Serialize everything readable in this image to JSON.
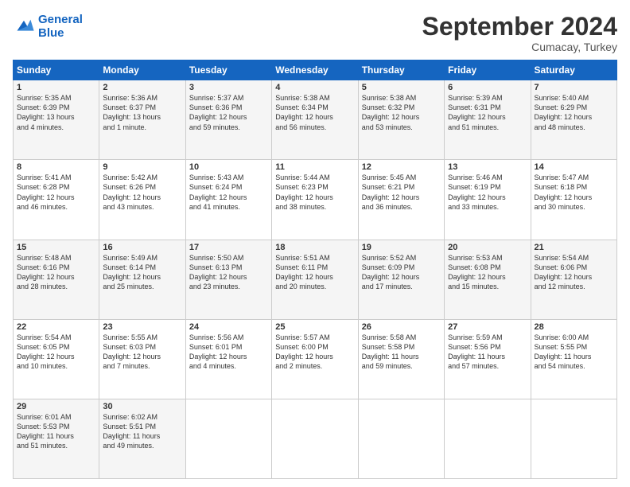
{
  "logo": {
    "line1": "General",
    "line2": "Blue"
  },
  "title": "September 2024",
  "location": "Cumacay, Turkey",
  "weekdays": [
    "Sunday",
    "Monday",
    "Tuesday",
    "Wednesday",
    "Thursday",
    "Friday",
    "Saturday"
  ],
  "rows": [
    [
      {
        "day": "1",
        "info": "Sunrise: 5:35 AM\nSunset: 6:39 PM\nDaylight: 13 hours\nand 4 minutes."
      },
      {
        "day": "2",
        "info": "Sunrise: 5:36 AM\nSunset: 6:37 PM\nDaylight: 13 hours\nand 1 minute."
      },
      {
        "day": "3",
        "info": "Sunrise: 5:37 AM\nSunset: 6:36 PM\nDaylight: 12 hours\nand 59 minutes."
      },
      {
        "day": "4",
        "info": "Sunrise: 5:38 AM\nSunset: 6:34 PM\nDaylight: 12 hours\nand 56 minutes."
      },
      {
        "day": "5",
        "info": "Sunrise: 5:38 AM\nSunset: 6:32 PM\nDaylight: 12 hours\nand 53 minutes."
      },
      {
        "day": "6",
        "info": "Sunrise: 5:39 AM\nSunset: 6:31 PM\nDaylight: 12 hours\nand 51 minutes."
      },
      {
        "day": "7",
        "info": "Sunrise: 5:40 AM\nSunset: 6:29 PM\nDaylight: 12 hours\nand 48 minutes."
      }
    ],
    [
      {
        "day": "8",
        "info": "Sunrise: 5:41 AM\nSunset: 6:28 PM\nDaylight: 12 hours\nand 46 minutes."
      },
      {
        "day": "9",
        "info": "Sunrise: 5:42 AM\nSunset: 6:26 PM\nDaylight: 12 hours\nand 43 minutes."
      },
      {
        "day": "10",
        "info": "Sunrise: 5:43 AM\nSunset: 6:24 PM\nDaylight: 12 hours\nand 41 minutes."
      },
      {
        "day": "11",
        "info": "Sunrise: 5:44 AM\nSunset: 6:23 PM\nDaylight: 12 hours\nand 38 minutes."
      },
      {
        "day": "12",
        "info": "Sunrise: 5:45 AM\nSunset: 6:21 PM\nDaylight: 12 hours\nand 36 minutes."
      },
      {
        "day": "13",
        "info": "Sunrise: 5:46 AM\nSunset: 6:19 PM\nDaylight: 12 hours\nand 33 minutes."
      },
      {
        "day": "14",
        "info": "Sunrise: 5:47 AM\nSunset: 6:18 PM\nDaylight: 12 hours\nand 30 minutes."
      }
    ],
    [
      {
        "day": "15",
        "info": "Sunrise: 5:48 AM\nSunset: 6:16 PM\nDaylight: 12 hours\nand 28 minutes."
      },
      {
        "day": "16",
        "info": "Sunrise: 5:49 AM\nSunset: 6:14 PM\nDaylight: 12 hours\nand 25 minutes."
      },
      {
        "day": "17",
        "info": "Sunrise: 5:50 AM\nSunset: 6:13 PM\nDaylight: 12 hours\nand 23 minutes."
      },
      {
        "day": "18",
        "info": "Sunrise: 5:51 AM\nSunset: 6:11 PM\nDaylight: 12 hours\nand 20 minutes."
      },
      {
        "day": "19",
        "info": "Sunrise: 5:52 AM\nSunset: 6:09 PM\nDaylight: 12 hours\nand 17 minutes."
      },
      {
        "day": "20",
        "info": "Sunrise: 5:53 AM\nSunset: 6:08 PM\nDaylight: 12 hours\nand 15 minutes."
      },
      {
        "day": "21",
        "info": "Sunrise: 5:54 AM\nSunset: 6:06 PM\nDaylight: 12 hours\nand 12 minutes."
      }
    ],
    [
      {
        "day": "22",
        "info": "Sunrise: 5:54 AM\nSunset: 6:05 PM\nDaylight: 12 hours\nand 10 minutes."
      },
      {
        "day": "23",
        "info": "Sunrise: 5:55 AM\nSunset: 6:03 PM\nDaylight: 12 hours\nand 7 minutes."
      },
      {
        "day": "24",
        "info": "Sunrise: 5:56 AM\nSunset: 6:01 PM\nDaylight: 12 hours\nand 4 minutes."
      },
      {
        "day": "25",
        "info": "Sunrise: 5:57 AM\nSunset: 6:00 PM\nDaylight: 12 hours\nand 2 minutes."
      },
      {
        "day": "26",
        "info": "Sunrise: 5:58 AM\nSunset: 5:58 PM\nDaylight: 11 hours\nand 59 minutes."
      },
      {
        "day": "27",
        "info": "Sunrise: 5:59 AM\nSunset: 5:56 PM\nDaylight: 11 hours\nand 57 minutes."
      },
      {
        "day": "28",
        "info": "Sunrise: 6:00 AM\nSunset: 5:55 PM\nDaylight: 11 hours\nand 54 minutes."
      }
    ],
    [
      {
        "day": "29",
        "info": "Sunrise: 6:01 AM\nSunset: 5:53 PM\nDaylight: 11 hours\nand 51 minutes."
      },
      {
        "day": "30",
        "info": "Sunrise: 6:02 AM\nSunset: 5:51 PM\nDaylight: 11 hours\nand 49 minutes."
      },
      null,
      null,
      null,
      null,
      null
    ]
  ]
}
